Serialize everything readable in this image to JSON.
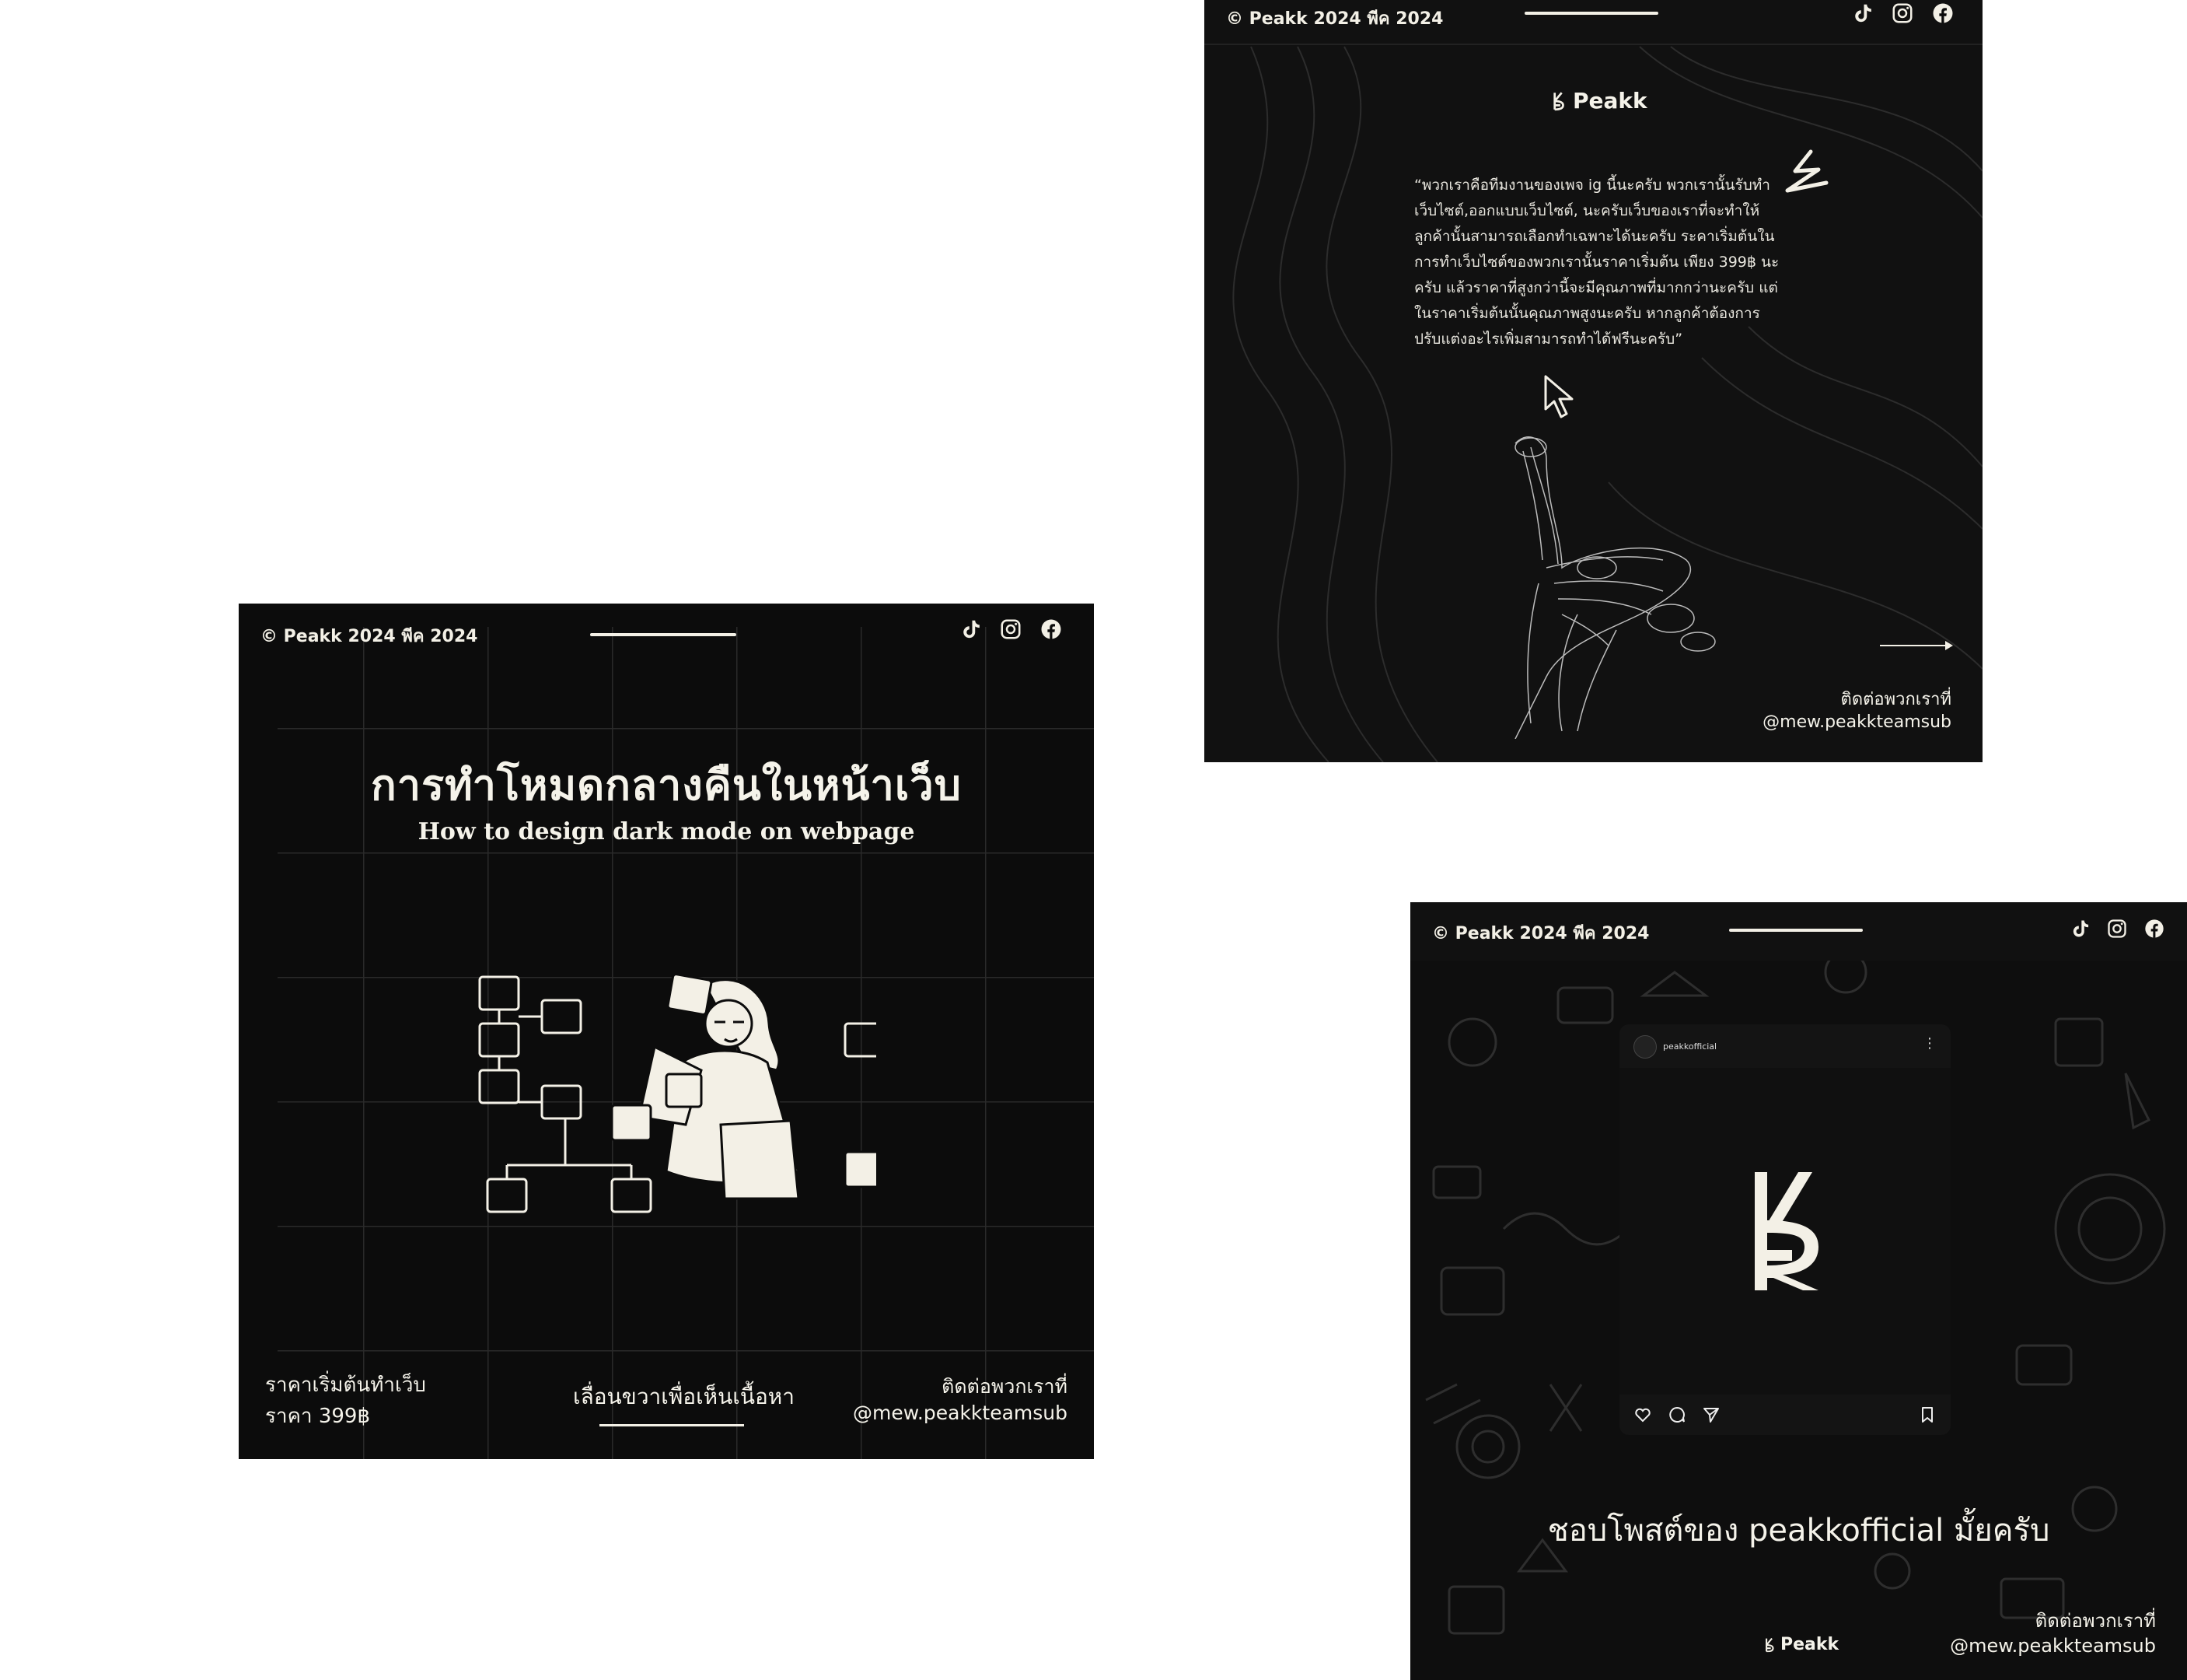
{
  "card_dark_mode": {
    "copyright": "© Peakk 2024 พีค 2024",
    "title": "การทำโหมดกลางคืนในหน้าเว็บ",
    "subtitle": "How to design dark mode on webpage",
    "price_line1": "ราคาเริ่มต้นทำเว็บ",
    "price_line2": "ราคา 399฿",
    "swipe_text": "เลื่อนขวาเพื่อเห็นเนื้อหา",
    "contact_label": "ติดต่อพวกเราที่",
    "contact_handle": "@mew.peakkteamsub"
  },
  "card_quote": {
    "copyright": "© Peakk 2024 พีค 2024",
    "logo_text": "Peakk",
    "quote": "“พวกเราคือทีมงานของเพจ ig นี้นะครับ พวกเรานั้นรับทำเว็บไซต์,ออกแบบเว็บไซต์, นะครับเว็บของเราที่จะทำให้ลูกค้านั้นสามารถเลือกทำเฉพาะได้นะครับ ระคาเริ่มต้นในการทำเว็บไซต์ของพวกเรานั้นราคาเริ่มต้น เพียง 399฿ นะครับ แล้วราคาที่สูงกว่านี้จะมีคุณภาพที่มากกว่านะครับ แต่ในราคาเริ่มต้นนั้นคุณภาพสูงนะครับ หากลูกค้าต้องการปรับแต่งอะไรเพิ่มสามารถทำได้ฟรีนะครับ”",
    "contact_label": "ติดต่อพวกเราที่",
    "contact_handle": "@mew.peakkteamsub"
  },
  "card_instagram": {
    "copyright": "© Peakk 2024 พีค 2024",
    "post_username": "peakkofficial",
    "cta": "ชอบโพสต์ของ peakkofficial มั้ยครับ",
    "logo_text": "Peakk",
    "contact_label": "ติดต่อพวกเราที่",
    "contact_handle": "@mew.peakkteamsub"
  },
  "icons": [
    "tiktok-icon",
    "instagram-icon",
    "facebook-icon",
    "heart-icon",
    "comment-icon",
    "send-icon",
    "bookmark-icon",
    "more-icon"
  ],
  "colors": {
    "background": "#ffffff",
    "card": "#0c0c0c",
    "ink": "#f3f0e6"
  }
}
